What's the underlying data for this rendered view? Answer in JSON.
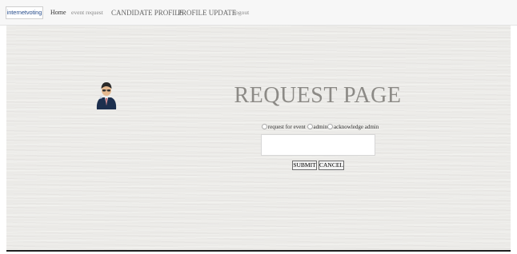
{
  "navbar": {
    "brand": "internetvoting",
    "links": {
      "home": "Home",
      "event_request": "event request",
      "candidate_profile": "CANDIDATE PROFILE",
      "profile_update": "PROFILE UPDATE",
      "logout": "logout"
    }
  },
  "main": {
    "title": "REQUEST PAGE",
    "avatar_icon": "user-avatar-icon",
    "radio_options": [
      {
        "label": "request for event"
      },
      {
        "label": "admin"
      },
      {
        "label": "acknowledge admin"
      }
    ],
    "message_value": "",
    "buttons": {
      "submit": "SUBMIT",
      "cancel": "CANCEL"
    }
  },
  "colors": {
    "background": "#ebeae7",
    "title": "#8c8a86",
    "bottom_rule": "#1e1e1e"
  }
}
